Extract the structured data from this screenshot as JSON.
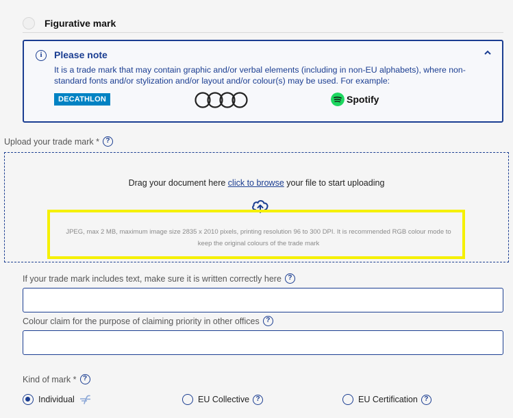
{
  "figurative": {
    "label": "Figurative mark"
  },
  "note": {
    "info_icon_glyph": "i",
    "title": "Please note",
    "text": "It is a trade mark that may contain graphic and/or verbal elements (including in non-EU alphabets), where non-standard fonts and/or stylization and/or layout and/or colour(s) may be used. For example:",
    "examples": {
      "decathlon": "DECATHLON",
      "spotify": "Spotify"
    }
  },
  "upload": {
    "label": "Upload your trade mark",
    "required_mark": "*",
    "help_glyph": "?",
    "drag_text_before": "Drag your document here ",
    "browse_link": "click to browse",
    "drag_text_after": " your file to start uploading",
    "hint": "JPEG, max 2 MB, maximum image size 2835 x 2010 pixels, printing resolution 96 to 300 DPI. It is recommended RGB colour mode to keep the original colours of the trade mark"
  },
  "text_field": {
    "label": "If your trade mark includes text, make sure it is written correctly here",
    "help_glyph": "?",
    "value": ""
  },
  "colour_field": {
    "label": "Colour claim for the purpose of claiming priority in other offices",
    "help_glyph": "?",
    "value": ""
  },
  "kind_of_mark": {
    "label": "Kind of mark",
    "required_mark": "*",
    "help_glyph": "?",
    "options": [
      {
        "label": "Individual",
        "checked": true
      },
      {
        "label": "EU Collective",
        "checked": false,
        "help_glyph": "?"
      },
      {
        "label": "EU Certification",
        "checked": false,
        "help_glyph": "?"
      }
    ]
  },
  "colors": {
    "primary": "#1a3d91",
    "highlight": "#f5f000",
    "decathlon_blue": "#0082c3",
    "spotify_green": "#1ed760"
  }
}
